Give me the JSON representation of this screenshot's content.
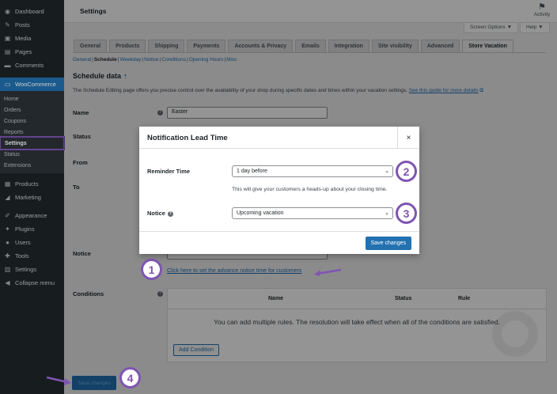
{
  "sidebar": {
    "items": [
      {
        "label": "Dashboard",
        "icon": "dashboard-icon",
        "glyph": "◉"
      },
      {
        "label": "Posts",
        "icon": "pin-icon",
        "glyph": "✎"
      },
      {
        "label": "Media",
        "icon": "media-icon",
        "glyph": "▣"
      },
      {
        "label": "Pages",
        "icon": "pages-icon",
        "glyph": "▤"
      },
      {
        "label": "Comments",
        "icon": "comments-icon",
        "glyph": "▬"
      }
    ],
    "woocommerce": {
      "label": "WooCommerce",
      "icon": "woo-icon",
      "glyph": "▭"
    },
    "woo_sub": [
      "Home",
      "Orders",
      "Coupons",
      "Reports",
      "Settings",
      "Status",
      "Extensions"
    ],
    "items2": [
      {
        "label": "Products",
        "icon": "products-icon",
        "glyph": "▦"
      },
      {
        "label": "Marketing",
        "icon": "marketing-icon",
        "glyph": "◢"
      }
    ],
    "items3": [
      {
        "label": "Appearance",
        "icon": "appearance-icon",
        "glyph": "✐"
      },
      {
        "label": "Plugins",
        "icon": "plugins-icon",
        "glyph": "✦"
      },
      {
        "label": "Users",
        "icon": "users-icon",
        "glyph": "●"
      },
      {
        "label": "Tools",
        "icon": "tools-icon",
        "glyph": "✚"
      },
      {
        "label": "Settings",
        "icon": "settings-icon",
        "glyph": "▥"
      },
      {
        "label": "Collapse menu",
        "icon": "collapse-icon",
        "glyph": "◀"
      }
    ]
  },
  "topbar": {
    "title": "Settings",
    "activity": "Activity"
  },
  "tools": {
    "screen_options": "Screen Options ▼",
    "help": "Help ▼"
  },
  "tabs": [
    "General",
    "Products",
    "Shipping",
    "Payments",
    "Accounts & Privacy",
    "Emails",
    "Integration",
    "Site visibility",
    "Advanced",
    "Store Vacation"
  ],
  "active_tab": "Store Vacation",
  "subnav": [
    "General",
    "Schedule",
    "Weekday",
    "Notice",
    "Conditions",
    "Opening Hours",
    "Misc"
  ],
  "section": {
    "title": "Schedule data",
    "up_arrow": "⇡",
    "description": "The Schedule Editing page offers you precise control over the availability of your shop during specific dates and times within your vacation settings.",
    "guide_link": "See this guide for more details"
  },
  "form": {
    "name_label": "Name",
    "name_value": "Easter",
    "status_label": "Status",
    "from_label": "From",
    "to_label": "To",
    "notice_label": "Notice",
    "notice_link": "Click here to set the advance notice time for customers",
    "conditions_label": "Conditions"
  },
  "conditions": {
    "headers": [
      "Name",
      "Status",
      "Rule"
    ],
    "empty": "You can add multiple rules. The resolution will take effect when all of the conditions are satisfied.",
    "add_button": "Add Condition"
  },
  "bottom_save": "Save changes",
  "modal": {
    "title": "Notification Lead Time",
    "close": "×",
    "reminder_label": "Reminder Time",
    "reminder_value": "1 day before",
    "hint": "This will give your customers a heads-up about your closing time.",
    "notice_label": "Notice",
    "notice_value": "Upcoming vacation",
    "save": "Save changes"
  },
  "badges": [
    "1",
    "2",
    "3",
    "4"
  ],
  "colors": {
    "accent": "#7f54b3",
    "primary": "#2271b1",
    "sidebar": "#1d2327"
  }
}
